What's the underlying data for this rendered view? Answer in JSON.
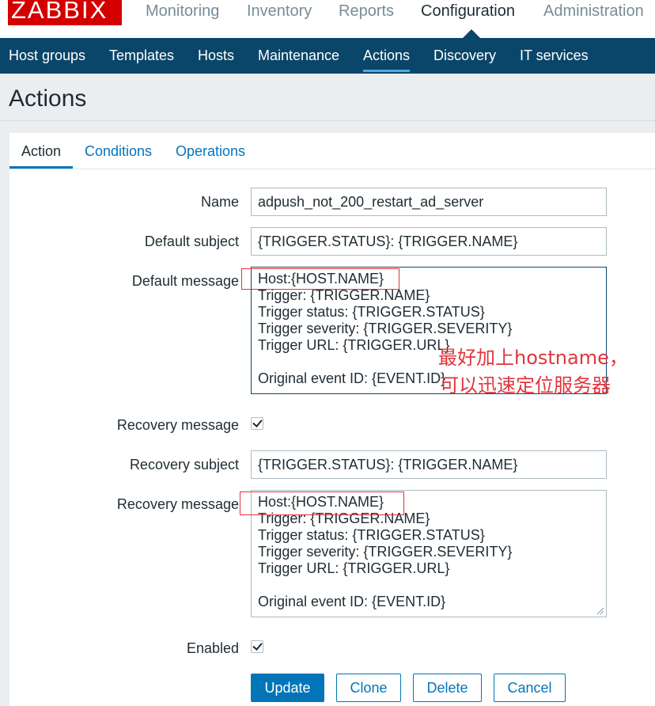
{
  "logo": {
    "text": "ZABBIX"
  },
  "top_menu": [
    {
      "label": "Monitoring"
    },
    {
      "label": "Inventory"
    },
    {
      "label": "Reports"
    },
    {
      "label": "Configuration"
    },
    {
      "label": "Administration"
    }
  ],
  "sub_menu": [
    {
      "label": "Host groups"
    },
    {
      "label": "Templates"
    },
    {
      "label": "Hosts"
    },
    {
      "label": "Maintenance"
    },
    {
      "label": "Actions"
    },
    {
      "label": "Discovery"
    },
    {
      "label": "IT services"
    }
  ],
  "page": {
    "title": "Actions"
  },
  "tabs": [
    {
      "label": "Action"
    },
    {
      "label": "Conditions"
    },
    {
      "label": "Operations"
    }
  ],
  "form": {
    "name": {
      "label": "Name",
      "value": "adpush_not_200_restart_ad_server"
    },
    "default_subject": {
      "label": "Default subject",
      "value": "{TRIGGER.STATUS}: {TRIGGER.NAME}"
    },
    "default_message": {
      "label": "Default message",
      "lines": [
        "Host:{HOST.NAME}",
        "Trigger: {TRIGGER.NAME}",
        "Trigger status: {TRIGGER.STATUS}",
        "Trigger severity: {TRIGGER.SEVERITY}",
        "Trigger URL: {TRIGGER.URL}",
        "",
        "Original event ID: {EVENT.ID}"
      ]
    },
    "recovery_enabled": {
      "label": "Recovery message",
      "checked": true
    },
    "recovery_subject": {
      "label": "Recovery subject",
      "value": "{TRIGGER.STATUS}: {TRIGGER.NAME}"
    },
    "recovery_message": {
      "label": "Recovery message",
      "lines": [
        "Host:{HOST.NAME}",
        "Trigger: {TRIGGER.NAME}",
        "Trigger status: {TRIGGER.STATUS}",
        "Trigger severity: {TRIGGER.SEVERITY}",
        "Trigger URL: {TRIGGER.URL}",
        "",
        "Original event ID: {EVENT.ID}"
      ]
    },
    "enabled": {
      "label": "Enabled",
      "checked": true
    }
  },
  "annotation": {
    "line1": "最好加上hostname，",
    "line2": "可以迅速定位服务器",
    "color": "#e0353c"
  },
  "buttons": {
    "update": "Update",
    "clone": "Clone",
    "delete": "Delete",
    "cancel": "Cancel"
  },
  "colors": {
    "header_bg": "#0a466a",
    "accent": "#0275b8",
    "logo_bg": "#d40000"
  }
}
